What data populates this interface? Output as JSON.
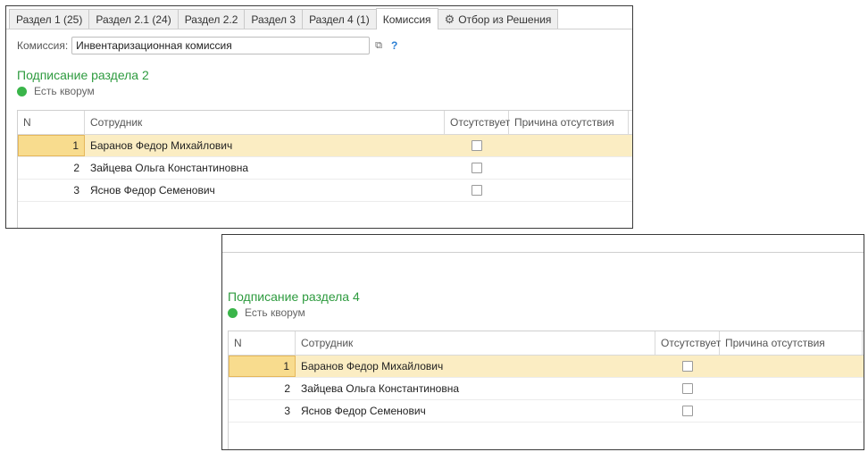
{
  "tabs": [
    {
      "label": "Раздел 1 (25)"
    },
    {
      "label": "Раздел 2.1 (24)"
    },
    {
      "label": "Раздел 2.2"
    },
    {
      "label": "Раздел 3"
    },
    {
      "label": "Раздел 4 (1)"
    },
    {
      "label": "Комиссия",
      "active": true
    },
    {
      "label": "Отбор из Решения",
      "icon": "gear-icon"
    }
  ],
  "komissiya": {
    "label": "Комиссия:",
    "value": "Инвентаризационная комиссия",
    "help": "?"
  },
  "section2": {
    "title": "Подписание раздела 2",
    "quorum": "Есть кворум",
    "columns": {
      "n": "N",
      "employee": "Сотрудник",
      "absent": "Отсутствует",
      "reason": "Причина отсутствия"
    },
    "rows": [
      {
        "n": "1",
        "name": "Баранов Федор Михайлович",
        "absent": false,
        "selected": true
      },
      {
        "n": "2",
        "name": "Зайцева Ольга Константиновна",
        "absent": false
      },
      {
        "n": "3",
        "name": "Яснов Федор Семенович",
        "absent": false
      }
    ]
  },
  "section4": {
    "title": "Подписание раздела 4",
    "quorum": "Есть кворум",
    "columns": {
      "n": "N",
      "employee": "Сотрудник",
      "absent": "Отсутствует",
      "reason": "Причина отсутствия"
    },
    "rows": [
      {
        "n": "1",
        "name": "Баранов Федор Михайлович",
        "absent": false,
        "selected": true
      },
      {
        "n": "2",
        "name": "Зайцева Ольга Константиновна",
        "absent": false
      },
      {
        "n": "3",
        "name": "Яснов Федор Семенович",
        "absent": false
      }
    ]
  },
  "colors": {
    "accent": "#2e9b3f",
    "selection": "#fbedc3",
    "quorum_dot": "#3ab54a"
  }
}
